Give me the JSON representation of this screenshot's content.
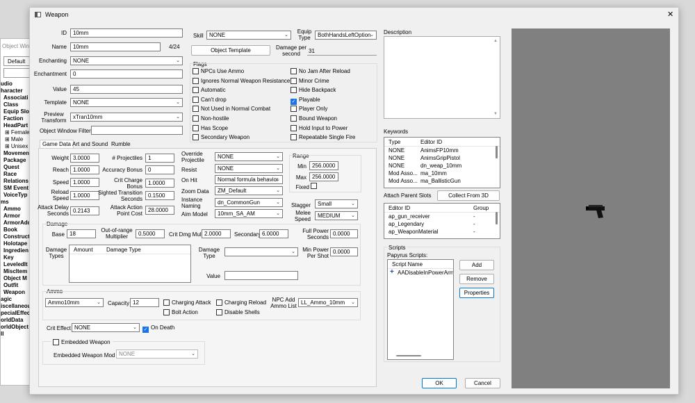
{
  "bg_window": {
    "title": "Object Windo",
    "filter_value": "Default",
    "tree": [
      "udio",
      "haracter",
      "Associati",
      "Class",
      "Equip Slo",
      "Faction",
      "HeadPart",
      "⊞ Female",
      "⊞ Male",
      "⊞ Unisex",
      "Movemen",
      "Package",
      "Quest",
      "Race",
      "Relations",
      "SM Event",
      "VoiceTyp",
      "ms",
      "Ammo",
      "Armor",
      "ArmorAdd",
      "Book",
      "Construct",
      "Holotape",
      "Ingredien",
      "Key",
      "LeveledIt",
      "MiscItem",
      "Object M",
      "Outfit",
      "Weapon",
      "agic",
      "iscellaneou",
      "pecialEffec",
      "orldData",
      "orldObject",
      "ll"
    ]
  },
  "window": {
    "title": "Weapon",
    "close": "✕"
  },
  "form": {
    "id_label": "ID",
    "id_value": "10mm",
    "name_label": "Name",
    "name_value": "10mm",
    "name_count": "4/24",
    "enchanting_label": "Enchanting",
    "enchanting_value": "NONE",
    "enchantment_label": "Enchantment",
    "enchantment_value": "0",
    "value_label": "Value",
    "value_value": "45",
    "template_label": "Template",
    "template_value": "NONE",
    "preview_label": "Preview\nTransform",
    "preview_value": "xTran10mm",
    "filter_label": "Object Window Filter",
    "filter_value": "",
    "skill_label": "Skill",
    "skill_value": "NONE",
    "equip_label": "Equip\nType",
    "equip_value": "BothHandsLeftOption",
    "object_template_btn": "Object Template",
    "dps_label": "Damage per\nsecond",
    "dps_value": "31",
    "description_label": "Description"
  },
  "flags": {
    "title": "Flags",
    "left": [
      {
        "label": "NPCs Use Ammo",
        "checked": false
      },
      {
        "label": "Ignores Normal Weapon Resistance",
        "checked": false
      },
      {
        "label": "Automatic",
        "checked": false
      },
      {
        "label": "Can't drop",
        "checked": false
      },
      {
        "label": "Not Used in Normal Combat",
        "checked": false
      },
      {
        "label": "Non-hostile",
        "checked": false
      },
      {
        "label": "Has Scope",
        "checked": false
      },
      {
        "label": "Secondary Weapon",
        "checked": false
      }
    ],
    "right": [
      {
        "label": "No Jam After Reload",
        "checked": false
      },
      {
        "label": "Minor Crime",
        "checked": false
      },
      {
        "label": "Hide Backpack",
        "checked": false
      },
      {
        "label": "Playable",
        "checked": true
      },
      {
        "label": "Player Only",
        "checked": false
      },
      {
        "label": "Bound Weapon",
        "checked": false
      },
      {
        "label": "Hold Input to Power",
        "checked": false
      },
      {
        "label": "Repeatable Single Fire",
        "checked": false
      }
    ]
  },
  "tabs": [
    "Game Data",
    "Art and Sound",
    "Rumble"
  ],
  "game": {
    "weight_label": "Weight",
    "weight": "3.0000",
    "reach_label": "Reach",
    "reach": "1.0000",
    "speed_label": "Speed",
    "speed": "1.0000",
    "reload_label": "Reload\nSpeed",
    "reload": "1.0000",
    "attack_delay_label": "Attack Delay\nSeconds",
    "attack_delay": "0.2143",
    "projectiles_label": "# Projectiles",
    "projectiles": "1",
    "accuracy_label": "Accuracy Bonus",
    "accuracy": "0",
    "crit_charge_label": "Crit Charge\nBonus",
    "crit_charge": "1.0000",
    "sighted_label": "Sighted Transition\nSeconds",
    "sighted": "0.1500",
    "ap_cost_label": "Attack Action\nPoint Cost",
    "ap_cost": "28.0000",
    "override_label": "Override\nProjectile",
    "override": "NONE",
    "resist_label": "Resist",
    "resist": "NONE",
    "onhit_label": "On Hit",
    "onhit": "Normal formula behavior",
    "zoom_label": "Zoom Data",
    "zoom": "ZM_Default",
    "instance_label": "Instance\nNaming",
    "instance": "dn_CommonGun",
    "aim_label": "Aim Model",
    "aim": "10mm_SA_AM",
    "range_title": "Range",
    "min_label": "Min",
    "min": "256.0000",
    "max_label": "Max",
    "max": "256.0000",
    "fixed_label": "Fixed",
    "stagger_label": "Stagger",
    "stagger": "Small",
    "melee_label": "Melee\nSpeed",
    "melee": "MEDIUM"
  },
  "damage": {
    "title": "Damage",
    "base_label": "Base",
    "base": "18",
    "oor_label": "Out-of-range\nMultiplier",
    "oor": "0.5000",
    "crit_mult_label": "Crit Dmg Mult",
    "crit_mult": "2.0000",
    "secondary_label": "Secondary",
    "secondary": "6.0000",
    "full_power_label": "Full Power\nSeconds",
    "full_power": "0.0000",
    "types_label": "Damage\nTypes",
    "col_amount": "Amount",
    "col_type": "Damage Type",
    "dtype_label": "Damage\nType",
    "dtype": "",
    "min_power_label": "Min Power\nPer Shot",
    "min_power": "0.0000",
    "value_label": "Value",
    "value": ""
  },
  "ammo": {
    "title": "Ammo",
    "ammo": "Ammo10mm",
    "capacity_label": "Capacity",
    "capacity": "12",
    "charging_attack": "Charging Attack",
    "charging_reload": "Charging Reload",
    "bolt_action": "Bolt Action",
    "disable_shells": "Disable Shells",
    "npc_add_label": "NPC Add\nAmmo List",
    "npc_add": "LL_Ammo_10mm"
  },
  "crit": {
    "label": "Crit Effect",
    "value": "NONE",
    "on_death": "On Death"
  },
  "embedded": {
    "title": "Embedded Weapon",
    "mod_label": "Embedded Weapon Mod",
    "mod_value": "NONE"
  },
  "keywords": {
    "title": "Keywords",
    "col_type": "Type",
    "col_id": "Editor ID",
    "rows": [
      {
        "type": "NONE",
        "id": "AnimsFP10mm"
      },
      {
        "type": "NONE",
        "id": "AnimsGripPistol"
      },
      {
        "type": "NONE",
        "id": "dn_weap_10mm"
      },
      {
        "type": "Mod Asso...",
        "id": "ma_10mm"
      },
      {
        "type": "Mod Asso...",
        "id": "ma_BallisticGun"
      }
    ]
  },
  "attach": {
    "title": "Attach Parent Slots",
    "collect_btn": "Collect From 3D",
    "col_id": "Editor ID",
    "col_group": "Group",
    "rows": [
      {
        "id": "ap_gun_receiver",
        "group": "-"
      },
      {
        "id": "ap_Legendary",
        "group": "-"
      },
      {
        "id": "ap_WeaponMaterial",
        "group": "-"
      }
    ]
  },
  "scripts": {
    "title": "Scripts",
    "sub": "Papyrus Scripts:",
    "col": "Script Name",
    "rows": [
      "AADisableInPowerArmo"
    ],
    "add": "Add",
    "remove": "Remove",
    "properties": "Properties"
  },
  "buttons": {
    "ok": "OK",
    "cancel": "Cancel"
  }
}
